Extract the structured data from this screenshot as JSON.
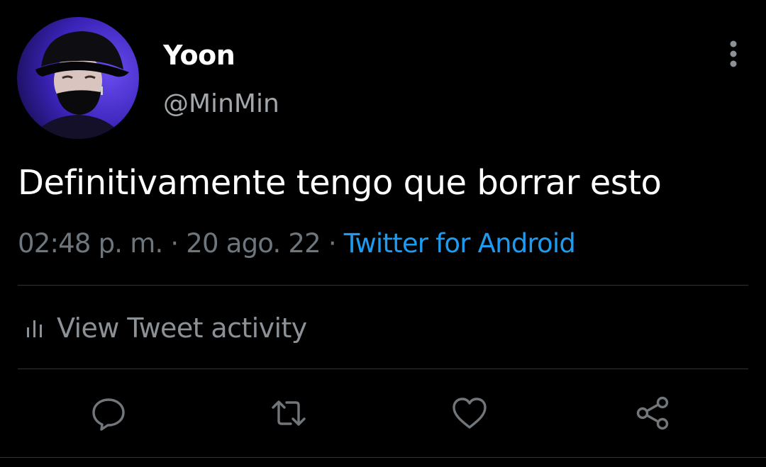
{
  "user": {
    "display_name": "Yoon",
    "handle": "@MinMin",
    "avatar_icon": "profile-photo"
  },
  "tweet": {
    "text": "Definitivamente tengo que borrar esto",
    "time": "02:48 p. m.",
    "date": "20 ago. 22",
    "separator": " · ",
    "source": "Twitter for Android"
  },
  "activity": {
    "label": "View Tweet activity",
    "icon": "bar-chart-icon"
  },
  "actions": {
    "reply_icon": "reply-icon",
    "retweet_icon": "retweet-icon",
    "like_icon": "heart-icon",
    "share_icon": "share-icon"
  },
  "colors": {
    "background": "#000000",
    "primary_text": "#ffffff",
    "secondary_text": "#6e767d",
    "link": "#1d9bf0",
    "divider": "#2f3336",
    "icon": "#71767b"
  }
}
